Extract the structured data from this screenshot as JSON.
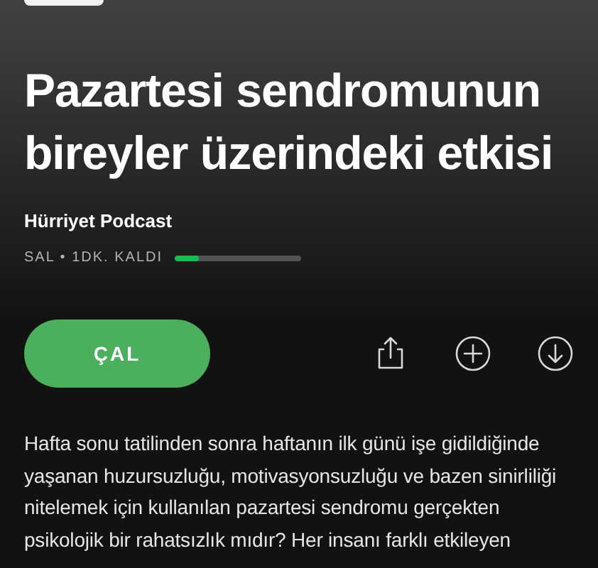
{
  "episode": {
    "title": "Pazartesi sendromunun bireyler üzerindeki etkisi",
    "show": "Hürriyet Podcast",
    "meta": "SAL • 1DK. KALDI",
    "level": 0.2
  },
  "play_button": {
    "label": "ÇAL"
  },
  "actions": [
    {
      "kind": "share"
    },
    {
      "kind": "add"
    },
    {
      "kind": "download"
    }
  ],
  "description": "Hafta sonu tatilinden sonra haftanın ilk günü işe gidildiğinde yaşanan huzursuzluğu, motivasyonsuzluğu ve bazen sinirliliği nitelemek için kullanılan pazartesi sendromu gerçekten psikolojik bir rahatsızlık mıdır? Her insanı farklı etkileyen"
}
